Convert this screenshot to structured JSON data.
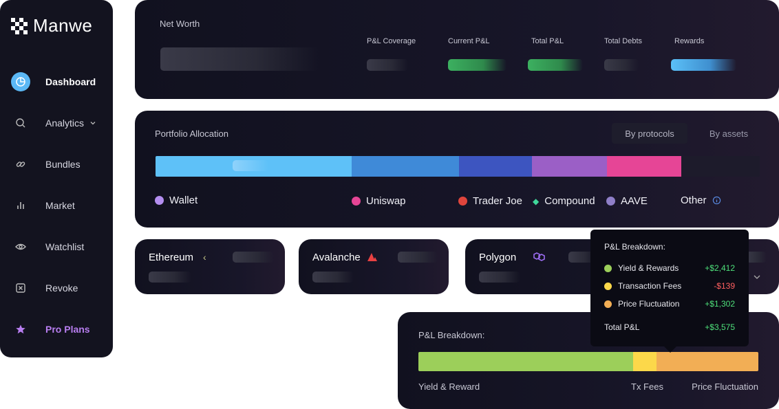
{
  "brand": {
    "name": "Manwe"
  },
  "sidebar": {
    "items": [
      {
        "label": "Dashboard",
        "icon": "pie-chart-icon"
      },
      {
        "label": "Analytics",
        "icon": "search-icon"
      },
      {
        "label": "Bundles",
        "icon": "link-icon"
      },
      {
        "label": "Market",
        "icon": "bar-chart-icon"
      },
      {
        "label": "Watchlist",
        "icon": "eye-icon"
      },
      {
        "label": "Revoke",
        "icon": "revoke-icon"
      },
      {
        "label": "Pro Plans",
        "icon": "star-icon"
      }
    ]
  },
  "networth": {
    "title": "Net Worth",
    "stats": [
      "P&L Coverage",
      "Current P&L",
      "Total P&L",
      "Total Debts",
      "Rewards"
    ]
  },
  "allocation": {
    "title": "Portfolio Allocation",
    "tabs": [
      "By protocols",
      "By assets"
    ],
    "segments": [
      {
        "name": "Wallet",
        "share": 0.325,
        "color": "#5ec1f8"
      },
      {
        "name": "Uniswap",
        "share": 0.177,
        "color": "#3f8ad8"
      },
      {
        "name": "Trader Joe",
        "share": 0.121,
        "color": "#3d55c0"
      },
      {
        "name": "Compound",
        "share": 0.124,
        "color": "#9b5fc6"
      },
      {
        "name": "AAVE",
        "share": 0.123,
        "color": "#e64596"
      },
      {
        "name": "Other",
        "share": 0.13,
        "color": "#1d1b2b"
      }
    ],
    "legend": [
      "Wallet",
      "Uniswap",
      "Trader Joe",
      "Compound",
      "AAVE",
      "Other"
    ]
  },
  "chains": [
    "Ethereum",
    "Avalanche",
    "Polygon"
  ],
  "tooltip": {
    "title": "P&L Breakdown:",
    "rows": [
      {
        "label": "Yield & Rewards",
        "value": "+$2,412",
        "color": "#9ccf5a",
        "value_color": "#4ee07a"
      },
      {
        "label": "Transaction Fees",
        "value": "-$139",
        "color": "#fcd84a",
        "value_color": "#ff6060"
      },
      {
        "label": "Price Fluctuation",
        "value": "+$1,302",
        "color": "#f2ae55",
        "value_color": "#4ee07a"
      }
    ],
    "total_label": "Total P&L",
    "total_value": "+$3,575"
  },
  "pnl": {
    "title": "P&L Breakdown:",
    "segments": [
      {
        "share": 0.632,
        "color": "#9ccf5a"
      },
      {
        "share": 0.069,
        "color": "#fcd84a"
      },
      {
        "share": 0.299,
        "color": "#f2ae55"
      }
    ],
    "labels": [
      "Yield & Reward",
      "Tx Fees",
      "Price Fluctuation"
    ]
  }
}
